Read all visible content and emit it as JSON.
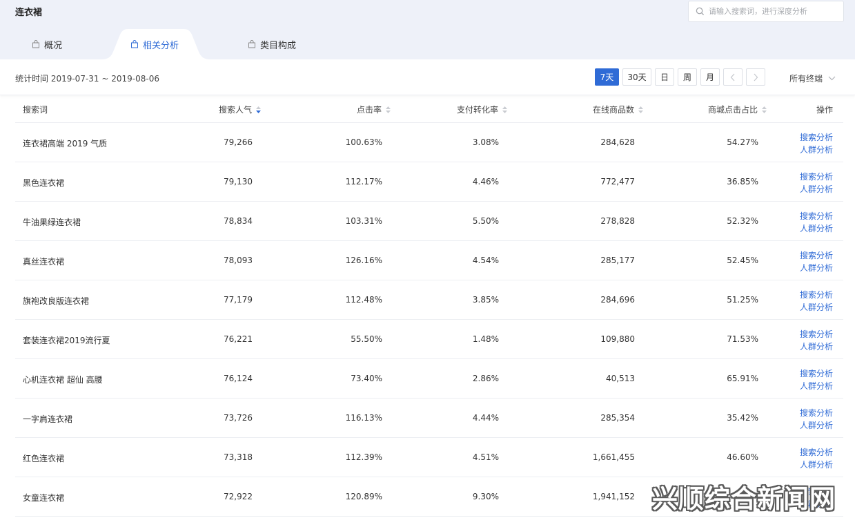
{
  "header": {
    "title": "连衣裙",
    "search_placeholder": "请输入搜索词，进行深度分析"
  },
  "tabs": [
    {
      "label": "概况",
      "active": false
    },
    {
      "label": "相关分析",
      "active": true
    },
    {
      "label": "类目构成",
      "active": false
    }
  ],
  "toolbar": {
    "stat_time": "统计时间 2019-07-31 ~ 2019-08-06",
    "ranges": [
      "7天",
      "30天",
      "日",
      "周",
      "月"
    ],
    "active_range": "7天",
    "terminal": "所有终端"
  },
  "table": {
    "columns": [
      "搜索词",
      "搜索人气",
      "点击率",
      "支付转化率",
      "在线商品数",
      "商城点击占比",
      "操作"
    ],
    "rows": [
      {
        "keyword": "连衣裙高端 2019 气质",
        "popularity": "79,266",
        "ctr": "100.63%",
        "conversion": "3.08%",
        "online": "284,628",
        "mall": "54.27%"
      },
      {
        "keyword": "黑色连衣裙",
        "popularity": "79,130",
        "ctr": "112.17%",
        "conversion": "4.46%",
        "online": "772,477",
        "mall": "36.85%"
      },
      {
        "keyword": "牛油果绿连衣裙",
        "popularity": "78,834",
        "ctr": "103.31%",
        "conversion": "5.50%",
        "online": "278,828",
        "mall": "52.32%"
      },
      {
        "keyword": "真丝连衣裙",
        "popularity": "78,093",
        "ctr": "126.16%",
        "conversion": "4.54%",
        "online": "285,177",
        "mall": "52.45%"
      },
      {
        "keyword": "旗袍改良版连衣裙",
        "popularity": "77,179",
        "ctr": "112.48%",
        "conversion": "3.85%",
        "online": "284,696",
        "mall": "51.25%"
      },
      {
        "keyword": "套装连衣裙2019流行夏",
        "popularity": "76,221",
        "ctr": "55.50%",
        "conversion": "1.48%",
        "online": "109,880",
        "mall": "71.53%"
      },
      {
        "keyword": "心机连衣裙 超仙 高腰",
        "popularity": "76,124",
        "ctr": "73.40%",
        "conversion": "2.86%",
        "online": "40,513",
        "mall": "65.91%"
      },
      {
        "keyword": "一字肩连衣裙",
        "popularity": "73,726",
        "ctr": "116.13%",
        "conversion": "4.44%",
        "online": "285,354",
        "mall": "35.42%"
      },
      {
        "keyword": "红色连衣裙",
        "popularity": "73,318",
        "ctr": "112.39%",
        "conversion": "4.51%",
        "online": "1,661,455",
        "mall": "46.60%"
      },
      {
        "keyword": "女童连衣裙",
        "popularity": "72,922",
        "ctr": "120.89%",
        "conversion": "9.30%",
        "online": "1,941,152",
        "mall": ""
      }
    ],
    "op_search": "搜索分析",
    "op_crowd": "人群分析"
  },
  "watermark": "兴顺综合新闻网",
  "colors": {
    "accent": "#2f6bd6",
    "header_bg": "#eef1f9"
  }
}
